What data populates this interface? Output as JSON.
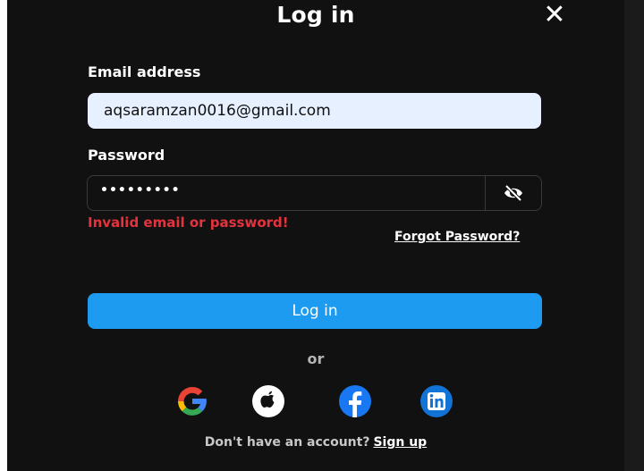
{
  "modal": {
    "title": "Log in",
    "close_glyph": "✕"
  },
  "form": {
    "email_label": "Email address",
    "email_value": "aqsaramzan0016@gmail.com",
    "password_label": "Password",
    "password_value": "•••••••••",
    "error_text": "Invalid email or password!",
    "forgot_link": "Forgot Password?",
    "submit_label": "Log in"
  },
  "social": {
    "divider_text": "or",
    "providers": [
      "google-icon",
      "apple-icon",
      "facebook-icon",
      "linkedin-icon"
    ]
  },
  "footer": {
    "prompt": "Don't have an account?",
    "signup_link": "Sign up"
  },
  "colors": {
    "background": "#111111",
    "accent": "#1d9bf0",
    "error": "#e5333d",
    "input_fill": "#e7f0fe"
  }
}
